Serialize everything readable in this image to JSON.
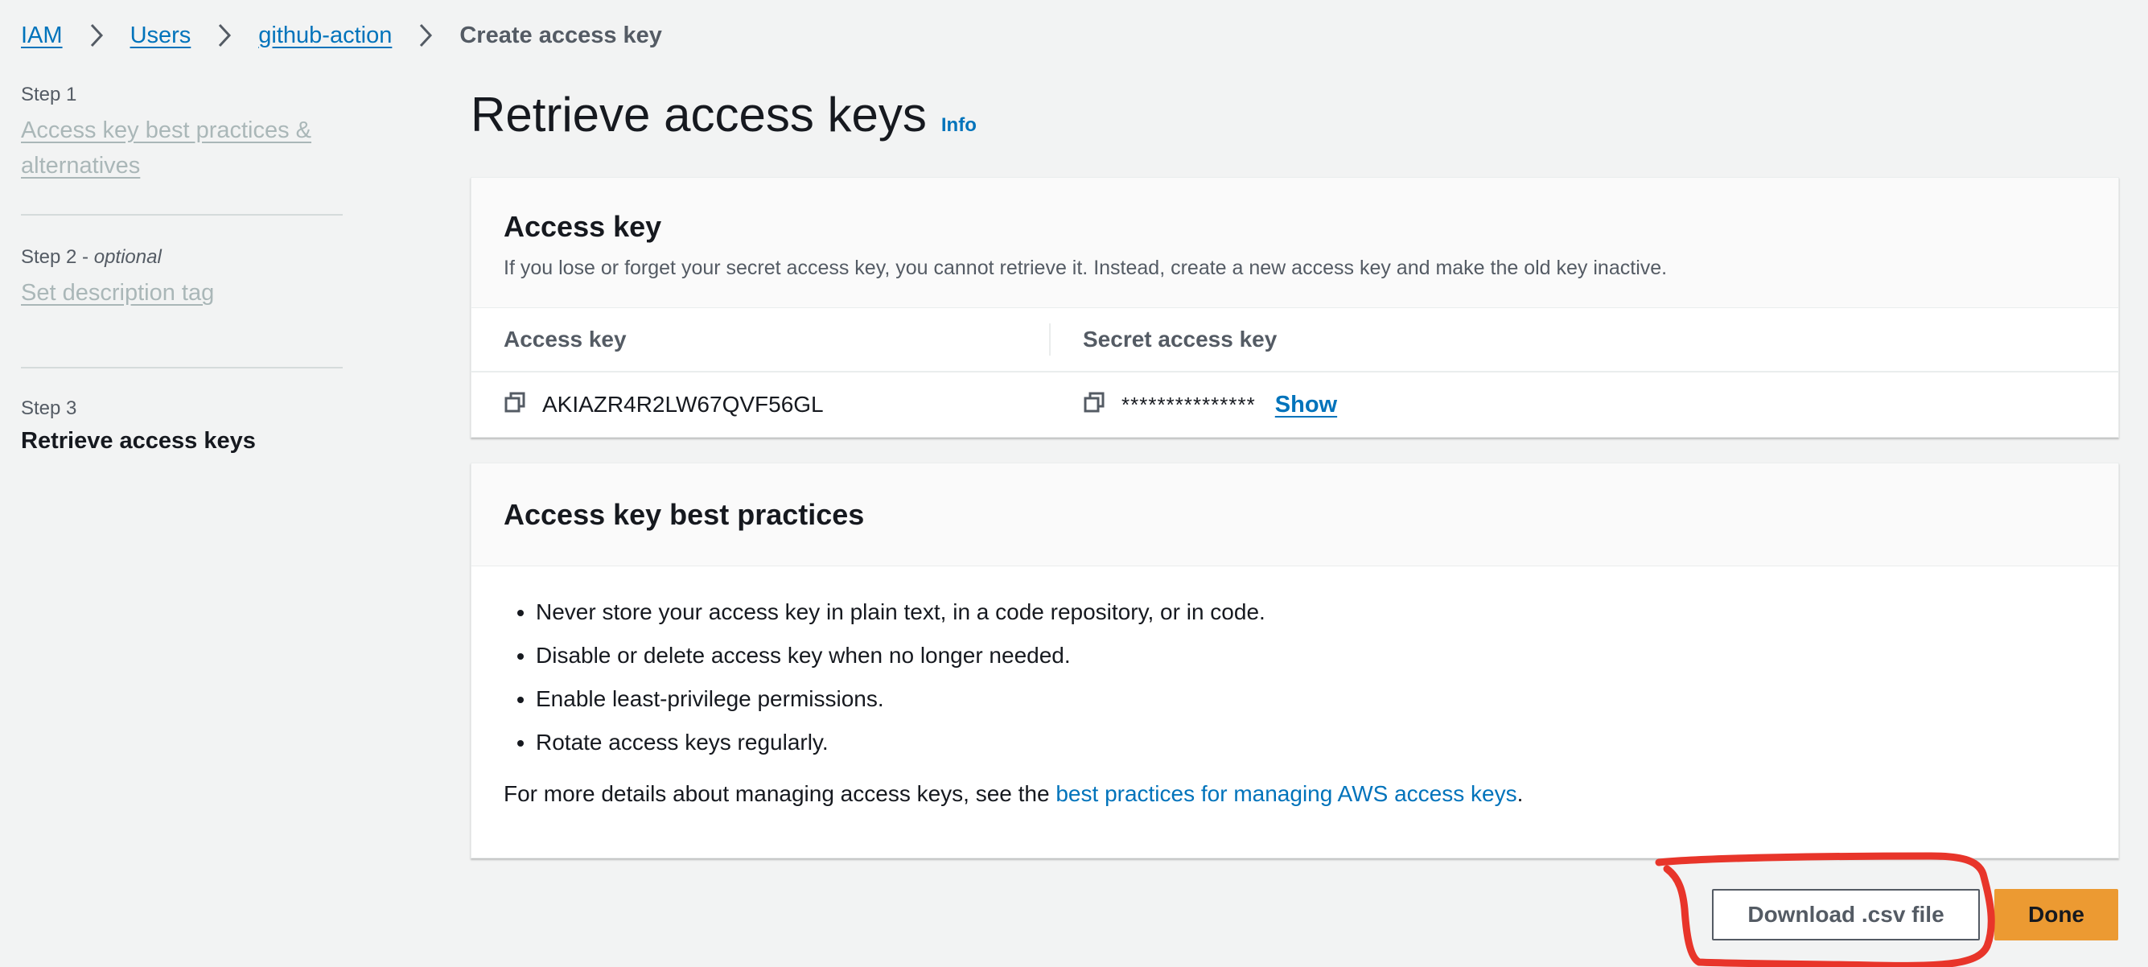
{
  "breadcrumb": {
    "items": [
      "IAM",
      "Users",
      "github-action"
    ],
    "current": "Create access key"
  },
  "steps": [
    {
      "label": "Step 1",
      "title": "Access key best practices & alternatives"
    },
    {
      "label": "Step 2",
      "optional": "optional",
      "separator": " - ",
      "title": "Set description tag"
    },
    {
      "label": "Step 3",
      "title": "Retrieve access keys"
    }
  ],
  "page": {
    "title": "Retrieve access keys",
    "info": "Info"
  },
  "access_key_panel": {
    "title": "Access key",
    "description": "If you lose or forget your secret access key, you cannot retrieve it. Instead, create a new access key and make the old key inactive.",
    "col_access_key": "Access key",
    "col_secret_key": "Secret access key",
    "access_key_value": "AKIAZR4R2LW67QVF56GL",
    "secret_mask": "***************",
    "show_label": "Show"
  },
  "best_practices_panel": {
    "title": "Access key best practices",
    "items": [
      "Never store your access key in plain text, in a code repository, or in code.",
      "Disable or delete access key when no longer needed.",
      "Enable least-privilege permissions.",
      "Rotate access keys regularly."
    ],
    "more_prefix": "For more details about managing access keys, see the ",
    "more_link": "best practices for managing AWS access keys",
    "more_suffix": "."
  },
  "buttons": {
    "download": "Download .csv file",
    "done": "Done"
  },
  "colors": {
    "link": "#0073bb",
    "primary": "#ec9a32",
    "annotation": "#e8352a",
    "background": "#f2f3f3"
  },
  "icons": [
    "chevron-right-icon",
    "copy-icon"
  ]
}
